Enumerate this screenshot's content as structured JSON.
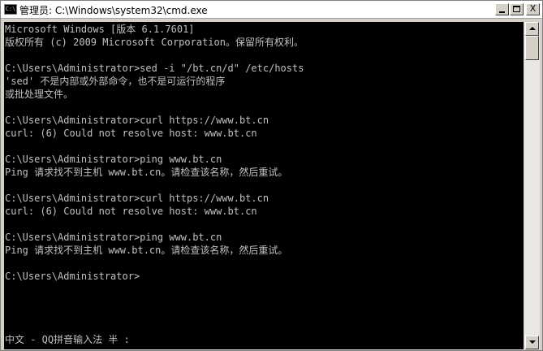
{
  "window": {
    "title": "管理员: C:\\Windows\\system32\\cmd.exe",
    "icon_label": "C:\\",
    "minimize_label": "",
    "close_label": "X"
  },
  "console": {
    "lines": [
      "Microsoft Windows [版本 6.1.7601]",
      "版权所有 (c) 2009 Microsoft Corporation。保留所有权利。",
      "",
      "C:\\Users\\Administrator>sed -i \"/bt.cn/d\" /etc/hosts",
      "'sed' 不是内部或外部命令，也不是可运行的程序",
      "或批处理文件。",
      "",
      "C:\\Users\\Administrator>curl https://www.bt.cn",
      "curl: (6) Could not resolve host: www.bt.cn",
      "",
      "C:\\Users\\Administrator>ping www.bt.cn",
      "Ping 请求找不到主机 www.bt.cn。请检查该名称，然后重试。",
      "",
      "C:\\Users\\Administrator>curl https://www.bt.cn",
      "curl: (6) Could not resolve host: www.bt.cn",
      "",
      "C:\\Users\\Administrator>ping www.bt.cn",
      "Ping 请求找不到主机 www.bt.cn。请检查该名称，然后重试。",
      "",
      "C:\\Users\\Administrator>"
    ],
    "ime_status": "中文 - QQ拼音输入法 半 :"
  },
  "colors": {
    "console_bg": "#000000",
    "console_fg": "#c0c0c0",
    "titlebar_bg": "#ffffff"
  }
}
